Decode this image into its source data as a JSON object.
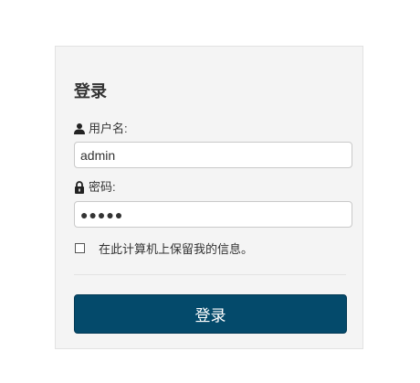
{
  "form": {
    "title": "登录",
    "username_label": "用户名:",
    "username_value": "admin",
    "password_label": "密码:",
    "password_value": "●●●●●",
    "remember_label": "在此计算机上保留我的信息。",
    "remember_checked": false,
    "submit_label": "登录"
  },
  "icons": {
    "username": "user-icon",
    "password": "lock-icon"
  },
  "colors": {
    "button_bg": "#044a6b",
    "panel_bg": "#f4f4f4"
  }
}
